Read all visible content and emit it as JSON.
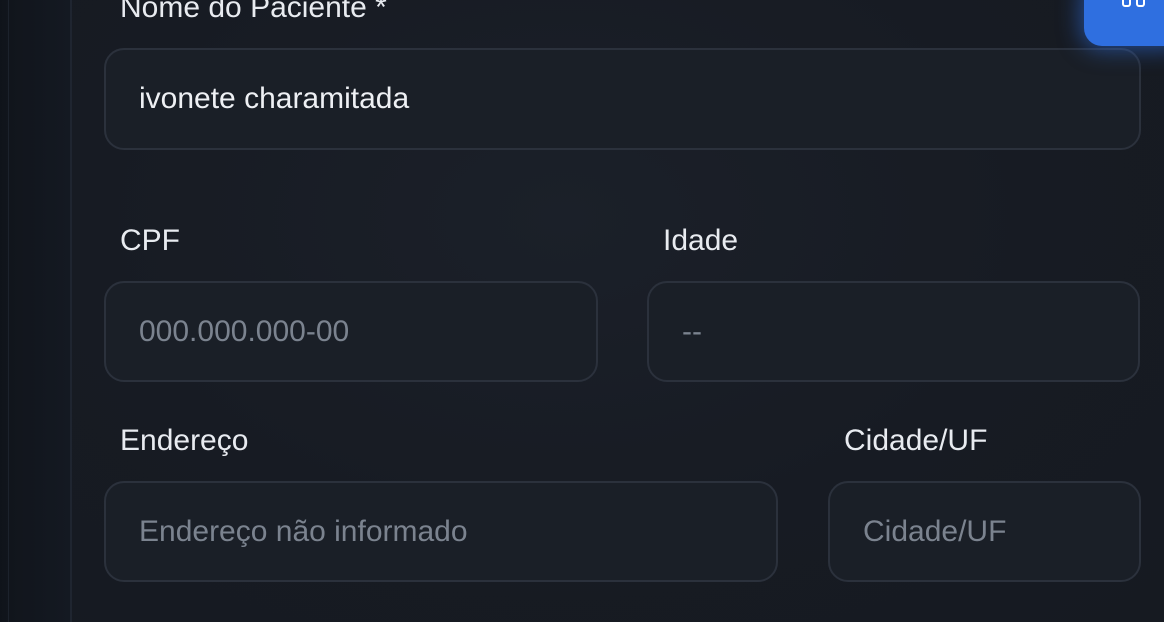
{
  "form": {
    "patient_name": {
      "label": "Nome do Paciente *",
      "value": "ivonete charamitada"
    },
    "cpf": {
      "label": "CPF",
      "placeholder": "000.000.000-00"
    },
    "age": {
      "label": "Idade",
      "placeholder": "--"
    },
    "address": {
      "label": "Endereço",
      "placeholder": "Endereço não informado"
    },
    "city": {
      "label": "Cidade/UF",
      "placeholder": "Cidade/UF"
    }
  },
  "action_button": {
    "icon": "grid-icon",
    "color": "#2f6fe0"
  }
}
